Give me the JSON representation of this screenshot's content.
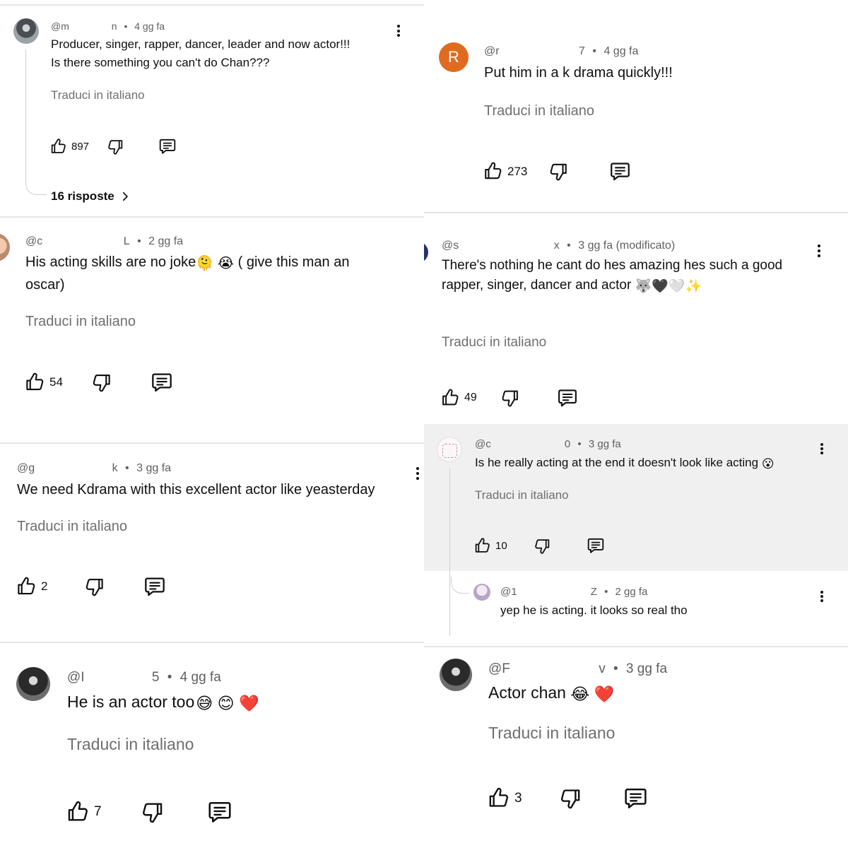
{
  "translate_label": "Traduci in italiano",
  "comments": {
    "c1": {
      "handle": "@m",
      "tail": "n",
      "time": "4 gg fa",
      "text_l1": "Producer, singer, rapper, dancer, leader and now actor!!!",
      "text_l2": "Is there something you can't do Chan???",
      "likes": "897",
      "replies_label": "16 risposte"
    },
    "c2": {
      "handle": "@r",
      "tail": "7",
      "time": "4 gg fa",
      "avatar_letter": "R",
      "text": "Put him in a k drama quickly!!!",
      "likes": "273"
    },
    "c3": {
      "handle": "@c",
      "tail": "L",
      "time": "2 gg fa",
      "text_l1": "His acting skills are no joke",
      "text_l1_tail": " ( give this man an",
      "text_l2": "oscar)",
      "emojis": [
        "🫠",
        "😭"
      ],
      "likes": "54"
    },
    "c4": {
      "handle": "@s",
      "tail": "x",
      "time": "3 gg fa (modificato)",
      "text_l1": "There's nothing he cant do hes amazing hes such a good",
      "text_l2": "rapper, singer, dancer and actor ",
      "emojis": [
        "🐺",
        "🖤",
        "🤍",
        "✨"
      ],
      "likes": "49"
    },
    "c5": {
      "handle": "@c",
      "tail": "0",
      "time": "3 gg fa",
      "text": "Is he really acting at the end it doesn't look like acting ",
      "emoji": "😮",
      "likes": "10"
    },
    "c6": {
      "handle": "@1",
      "tail": "Z",
      "time": "2 gg fa",
      "text": "yep he is acting. it looks so real tho"
    },
    "c7": {
      "handle": "@g",
      "tail": "k",
      "time": "3 gg fa",
      "text": "We need Kdrama with this excellent actor like yeasterday",
      "likes": "2"
    },
    "c8": {
      "handle": "@I",
      "tail": "5",
      "time": "4 gg fa",
      "text": "He is an actor too",
      "emojis": [
        "😅",
        "😊",
        "❤️"
      ],
      "likes": "7"
    },
    "c9": {
      "handle": "@F",
      "tail": "v",
      "time": "3 gg fa",
      "text": "Actor chan ",
      "emojis": [
        "😂",
        "❤️"
      ],
      "likes": "3"
    }
  },
  "colors": {
    "avatar_orange": "#e06b1f",
    "highlight_bg": "#f0f0f0",
    "meta_gray": "#606060",
    "translate_gray": "#6f6f6f"
  }
}
